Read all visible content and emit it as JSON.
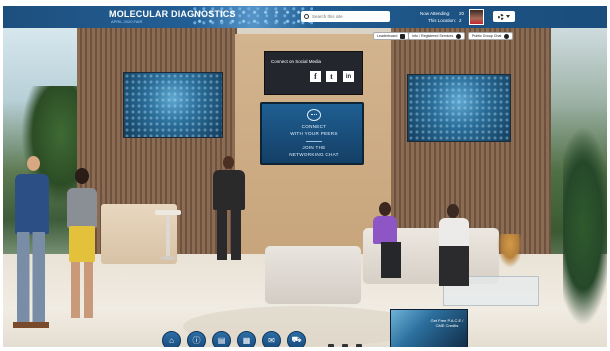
{
  "header": {
    "title": "MOLECULAR DIAGNOSTICS",
    "subtitle": "APRIL 2020 FAIR",
    "search_placeholder": "Search this site",
    "now_attending_label": "Now Attending:",
    "now_attending_value": "20",
    "location_label": "This Location:",
    "location_value": "2"
  },
  "quick_tabs": [
    {
      "label": "Leaderboard"
    },
    {
      "label": "Info / Registered Services"
    },
    {
      "label": "Public Group Chat"
    }
  ],
  "social": {
    "title": "Connect on Social Media",
    "facebook": "f",
    "twitter": "t",
    "linkedin": "in"
  },
  "chat": {
    "line1": "CONNECT",
    "line2": "WITH YOUR PEERS",
    "line3": "JOIN THE",
    "line4": "NETWORKING CHAT"
  },
  "promo": {
    "title": "Get Free P.A.C.E / CME Credits"
  },
  "dock": {
    "icons": [
      "lobby-icon",
      "info-icon",
      "print-icon",
      "agenda-icon",
      "chat-icon",
      "cart-icon"
    ]
  },
  "colors": {
    "topbar": "#1d4f7e",
    "accent": "#2d6ea7"
  }
}
